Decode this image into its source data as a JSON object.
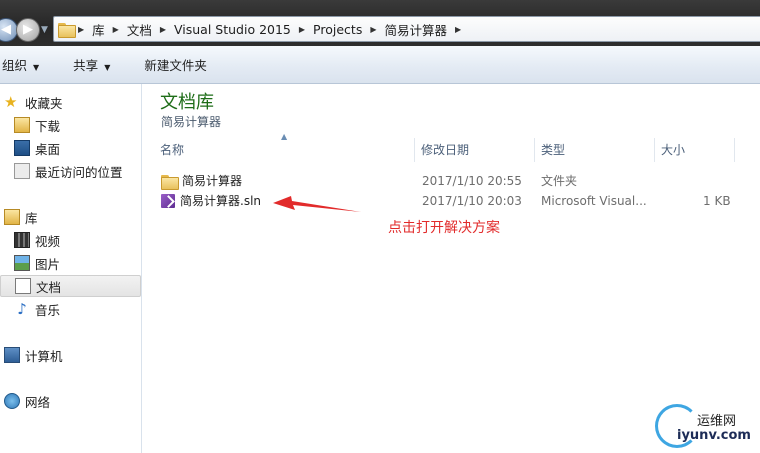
{
  "address": {
    "breadcrumbs": [
      "库",
      "文档",
      "Visual Studio 2015",
      "Projects",
      "简易计算器"
    ]
  },
  "toolbar": {
    "organize_label": "组织",
    "share_label": "共享",
    "new_folder_label": "新建文件夹"
  },
  "nav": {
    "favorites": {
      "label": "收藏夹",
      "items": [
        {
          "label": "下载",
          "icon": "download-icon"
        },
        {
          "label": "桌面",
          "icon": "desktop-icon"
        },
        {
          "label": "最近访问的位置",
          "icon": "recent-places-icon"
        }
      ]
    },
    "libraries": {
      "label": "库",
      "items": [
        {
          "label": "视频",
          "icon": "video-icon"
        },
        {
          "label": "图片",
          "icon": "pictures-icon"
        },
        {
          "label": "文档",
          "icon": "documents-icon",
          "selected": true
        },
        {
          "label": "音乐",
          "icon": "music-icon"
        }
      ]
    },
    "computer": {
      "label": "计算机"
    },
    "network": {
      "label": "网络"
    }
  },
  "content": {
    "library_title": "文档库",
    "library_subtitle": "简易计算器",
    "columns": {
      "name": "名称",
      "modified": "修改日期",
      "type": "类型",
      "size": "大小"
    },
    "files": [
      {
        "name": "简易计算器",
        "modified": "2017/1/10 20:55",
        "type": "文件夹",
        "size": "",
        "icon": "folder-icon"
      },
      {
        "name": "简易计算器.sln",
        "modified": "2017/1/10 20:03",
        "type": "Microsoft Visual...",
        "size": "1 KB",
        "icon": "visual-studio-solution-icon"
      }
    ]
  },
  "annotation": {
    "text": "点击打开解决方案",
    "color": "#e22b2b"
  },
  "watermark": {
    "name_cn": "运维网",
    "domain": "iyunv.com"
  }
}
